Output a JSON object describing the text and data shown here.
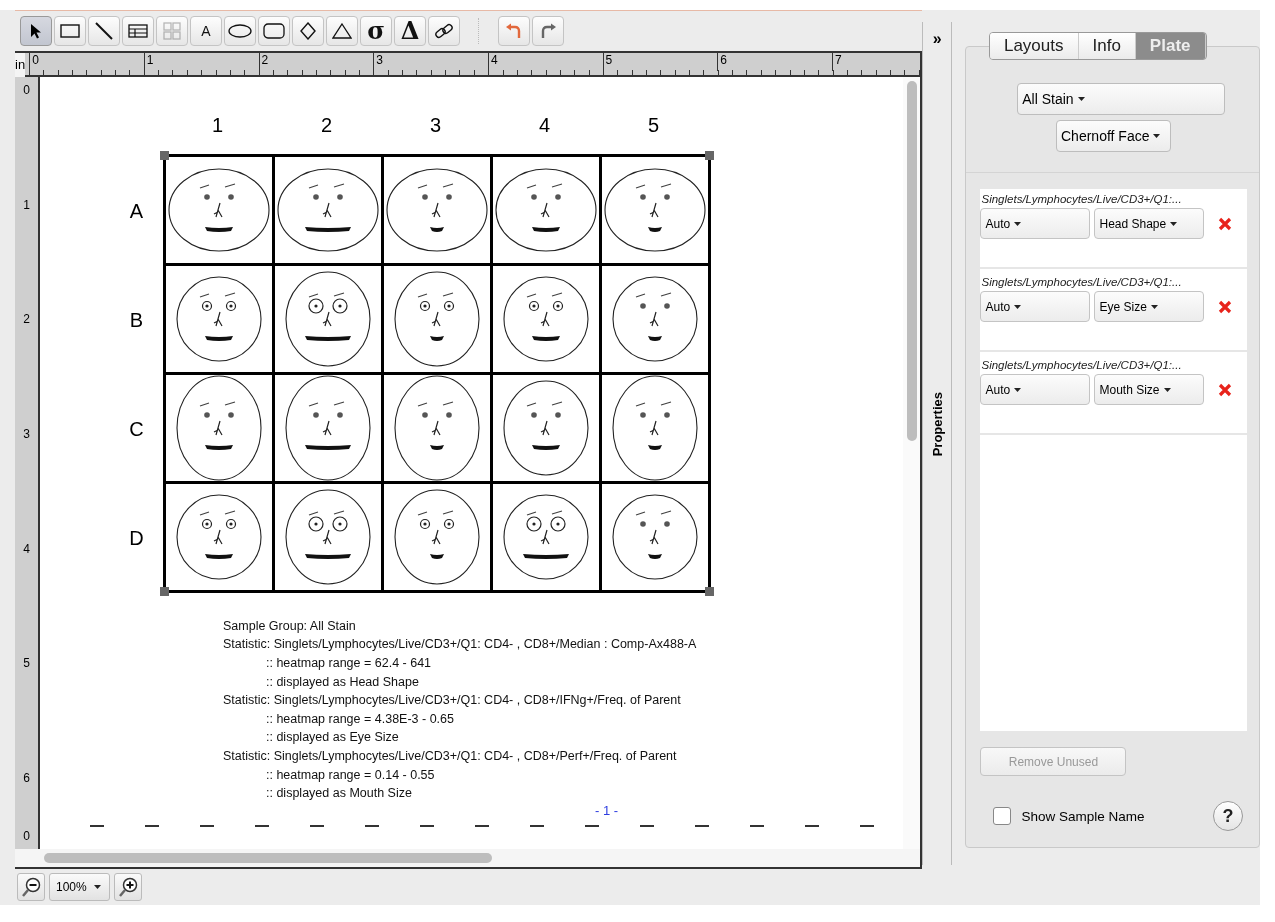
{
  "toolbar": {
    "tools": [
      {
        "kind": "pointer",
        "selected": true,
        "disabled": false
      },
      {
        "kind": "rectangle",
        "selected": false,
        "disabled": false
      },
      {
        "kind": "line",
        "selected": false,
        "disabled": false
      },
      {
        "kind": "table",
        "selected": false,
        "disabled": false
      },
      {
        "kind": "grid",
        "selected": false,
        "disabled": true
      },
      {
        "kind": "letter",
        "glyph": "A",
        "selected": false,
        "disabled": false
      },
      {
        "kind": "ellipse",
        "selected": false,
        "disabled": false
      },
      {
        "kind": "rounded",
        "selected": false,
        "disabled": false
      },
      {
        "kind": "diamond",
        "selected": false,
        "disabled": false
      },
      {
        "kind": "triangle",
        "selected": false,
        "disabled": false
      },
      {
        "kind": "symbol",
        "glyph": "σ",
        "selected": false,
        "disabled": false
      },
      {
        "kind": "symbol",
        "glyph": "Δ",
        "selected": false,
        "disabled": false
      },
      {
        "kind": "link",
        "selected": false,
        "disabled": false
      }
    ],
    "history": [
      {
        "kind": "undo"
      },
      {
        "kind": "redo"
      }
    ]
  },
  "ruler": {
    "unit": "in",
    "x_labels": [
      "0",
      "1",
      "2",
      "3",
      "4",
      "5",
      "6",
      "7"
    ],
    "y_labels": [
      "0",
      "1",
      "2",
      "3",
      "4",
      "5",
      "6",
      "0"
    ]
  },
  "plate": {
    "columns": [
      "1",
      "2",
      "3",
      "4",
      "5"
    ],
    "rows": [
      "A",
      "B",
      "C",
      "D"
    ]
  },
  "legend": {
    "sample_group": "Sample Group: All Stain",
    "statistics": [
      {
        "text": "Statistic: Singlets/Lymphocytes/Live/CD3+/Q1: CD4- , CD8+/Median : Comp-Ax488-A",
        "details": [
          ":: heatmap range = 62.4 - 641",
          ":: displayed as Head Shape"
        ]
      },
      {
        "text": "Statistic: Singlets/Lymphocytes/Live/CD3+/Q1: CD4- , CD8+/IFNg+/Freq. of Parent",
        "details": [
          ":: heatmap range = 4.38E-3 - 0.65",
          ":: displayed as Eye Size"
        ]
      },
      {
        "text": "Statistic: Singlets/Lymphocytes/Live/CD3+/Q1: CD4- , CD8+/Perf+/Freq. of Parent",
        "details": [
          ":: heatmap range = 0.14 - 0.55",
          ":: displayed as Mouth Size"
        ]
      }
    ]
  },
  "page_number": "- 1 -",
  "zoom": {
    "value": "100%"
  },
  "side_strip": {
    "toggle": "»",
    "label": "Properties"
  },
  "panel": {
    "tabs": [
      {
        "label": "Layouts",
        "selected": false
      },
      {
        "label": "Info",
        "selected": false
      },
      {
        "label": "Plate",
        "selected": true
      }
    ],
    "group_dropdown": "All Stain",
    "type_dropdown": "Chernoff Face",
    "statistics": [
      {
        "path": "Singlets/Lymphocytes/Live/CD3+/Q1:...",
        "scale": "Auto",
        "feature": "Head Shape"
      },
      {
        "path": "Singlets/Lymphocytes/Live/CD3+/Q1:...",
        "scale": "Auto",
        "feature": "Eye Size"
      },
      {
        "path": "Singlets/Lymphocytes/Live/CD3+/Q1:...",
        "scale": "Auto",
        "feature": "Mouth Size"
      }
    ],
    "remove_button": {
      "label": "Remove Unused",
      "disabled": true
    },
    "show_sample_name": {
      "label": "Show Sample Name",
      "checked": false
    },
    "help": "?"
  }
}
